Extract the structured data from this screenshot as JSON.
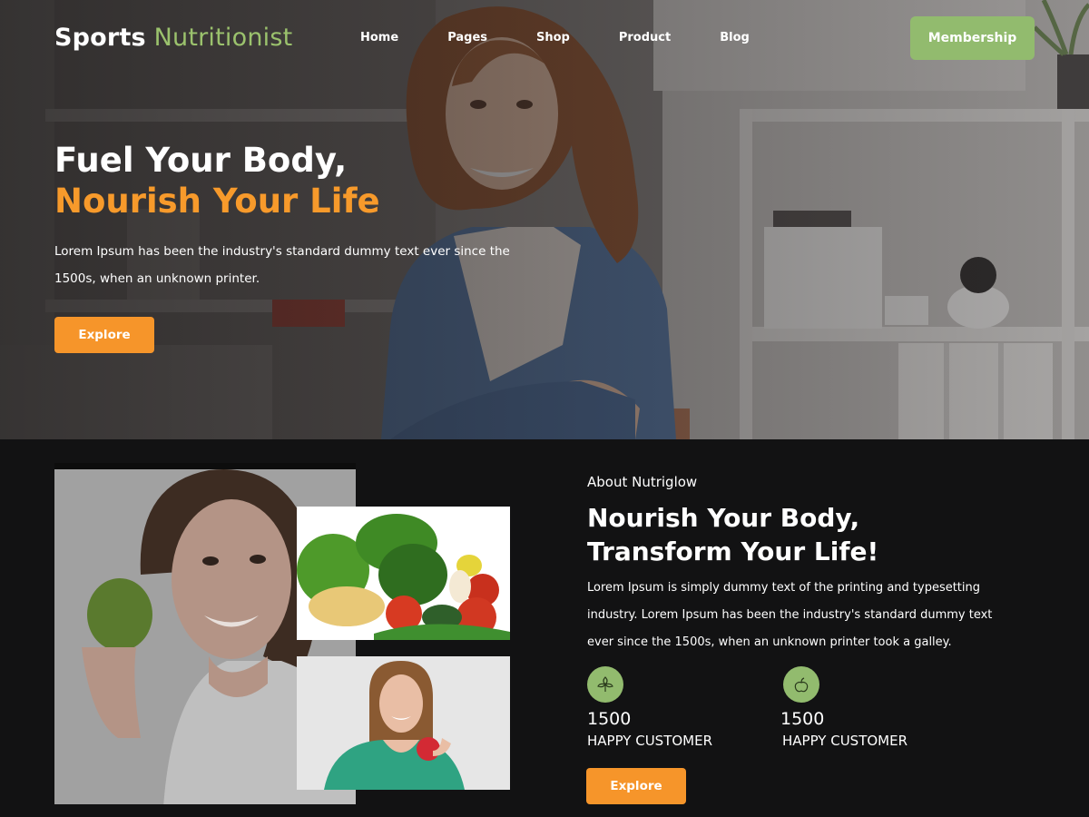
{
  "brand": {
    "part1": "Sports",
    "part2": "Nutritionist",
    "accent": "#9bc26d"
  },
  "nav": {
    "items": [
      "Home",
      "Pages",
      "Shop",
      "Product",
      "Blog"
    ]
  },
  "header": {
    "membership_label": "Membership",
    "membership_color": "#92bb6e"
  },
  "hero": {
    "title_line1": "Fuel Your Body,",
    "title_line2": "Nourish Your Life",
    "title_line2_color": "#f79a2b",
    "text": "Lorem Ipsum has been the industry's standard dummy text ever since the 1500s, when an unknown printer.",
    "button_label": "Explore",
    "button_color": "#f6952a"
  },
  "about": {
    "kicker": "About Nutriglow",
    "title_line1": "Nourish Your Body,",
    "title_line2": "Transform Your Life!",
    "text": "Lorem Ipsum is simply dummy text of the printing and typesetting industry. Lorem Ipsum has been the industry's standard dummy text ever since the 1500s, when an unknown printer took a galley.",
    "stats": [
      {
        "icon": "leaf-icon",
        "value": "1500",
        "label": "HAPPY CUSTOMER"
      },
      {
        "icon": "apple-icon",
        "value": "1500",
        "label": "HAPPY CUSTOMER"
      }
    ],
    "button_label": "Explore"
  }
}
